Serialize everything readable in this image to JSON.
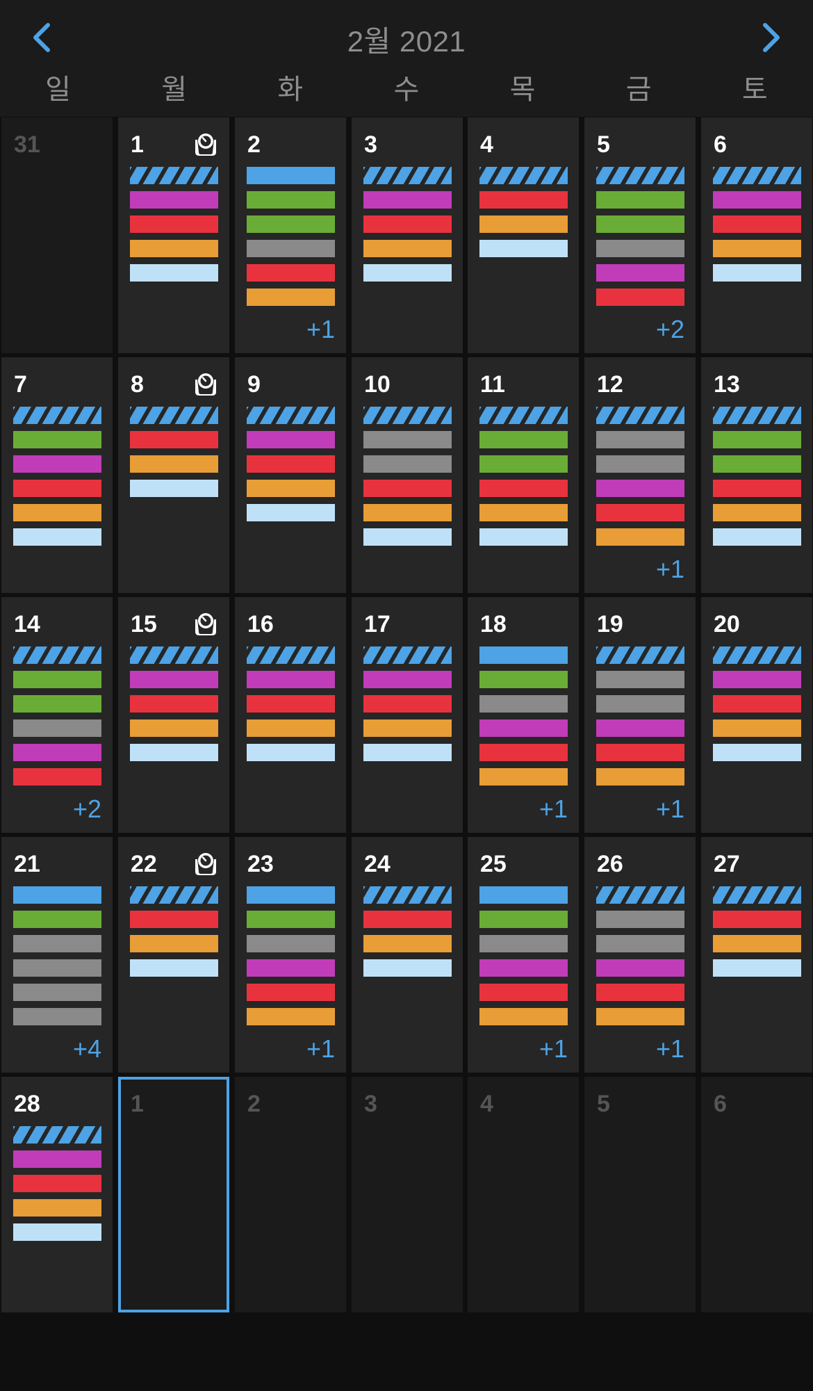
{
  "header": {
    "title": "2월 2021",
    "prev_icon": "chevron-left-icon",
    "next_icon": "chevron-right-icon",
    "accent": "#4da3e5"
  },
  "weekdays": [
    "일",
    "월",
    "화",
    "수",
    "목",
    "금",
    "토"
  ],
  "colors": {
    "stripe": "#4da3e5",
    "blue": "#4da3e5",
    "purple": "#c13cb8",
    "red": "#e8333f",
    "orange": "#e89d37",
    "lightblue": "#bfe1f7",
    "green": "#6aad36",
    "gray": "#8a8a8a"
  },
  "weeks": [
    [
      {
        "day": "31",
        "outside": true,
        "bars": []
      },
      {
        "day": "1",
        "icon": "timer-icon",
        "bars": [
          "stripe",
          "purple",
          "red",
          "orange",
          "lightblue"
        ]
      },
      {
        "day": "2",
        "bars": [
          "blue",
          "green",
          "green",
          "gray",
          "red",
          "orange"
        ],
        "more": "+1"
      },
      {
        "day": "3",
        "bars": [
          "stripe",
          "purple",
          "red",
          "orange",
          "lightblue"
        ]
      },
      {
        "day": "4",
        "bars": [
          "stripe",
          "red",
          "orange",
          "lightblue"
        ]
      },
      {
        "day": "5",
        "bars": [
          "stripe",
          "green",
          "green",
          "gray",
          "purple",
          "red"
        ],
        "more": "+2"
      },
      {
        "day": "6",
        "bars": [
          "stripe",
          "purple",
          "red",
          "orange",
          "lightblue"
        ]
      }
    ],
    [
      {
        "day": "7",
        "bars": [
          "stripe",
          "green",
          "purple",
          "red",
          "orange",
          "lightblue"
        ]
      },
      {
        "day": "8",
        "icon": "timer-icon",
        "bars": [
          "stripe",
          "red",
          "orange",
          "lightblue"
        ]
      },
      {
        "day": "9",
        "bars": [
          "stripe",
          "purple",
          "red",
          "orange",
          "lightblue"
        ]
      },
      {
        "day": "10",
        "bars": [
          "stripe",
          "gray",
          "gray",
          "red",
          "orange",
          "lightblue"
        ]
      },
      {
        "day": "11",
        "bars": [
          "stripe",
          "green",
          "green",
          "red",
          "orange",
          "lightblue"
        ]
      },
      {
        "day": "12",
        "bars": [
          "stripe",
          "gray",
          "gray",
          "purple",
          "red",
          "orange"
        ],
        "more": "+1"
      },
      {
        "day": "13",
        "bars": [
          "stripe",
          "green",
          "green",
          "red",
          "orange",
          "lightblue"
        ]
      }
    ],
    [
      {
        "day": "14",
        "bars": [
          "stripe",
          "green",
          "green",
          "gray",
          "purple",
          "red"
        ],
        "more": "+2"
      },
      {
        "day": "15",
        "icon": "timer-icon",
        "bars": [
          "stripe",
          "purple",
          "red",
          "orange",
          "lightblue"
        ]
      },
      {
        "day": "16",
        "bars": [
          "stripe",
          "purple",
          "red",
          "orange",
          "lightblue"
        ]
      },
      {
        "day": "17",
        "bars": [
          "stripe",
          "purple",
          "red",
          "orange",
          "lightblue"
        ]
      },
      {
        "day": "18",
        "bars": [
          "blue",
          "green",
          "gray",
          "purple",
          "red",
          "orange"
        ],
        "more": "+1"
      },
      {
        "day": "19",
        "bars": [
          "stripe",
          "gray",
          "gray",
          "purple",
          "red",
          "orange"
        ],
        "more": "+1"
      },
      {
        "day": "20",
        "bars": [
          "stripe",
          "purple",
          "red",
          "orange",
          "lightblue"
        ]
      }
    ],
    [
      {
        "day": "21",
        "bars": [
          "blue",
          "green",
          "gray",
          "gray",
          "gray",
          "gray"
        ],
        "more": "+4"
      },
      {
        "day": "22",
        "icon": "timer-icon",
        "bars": [
          "stripe",
          "red",
          "orange",
          "lightblue"
        ]
      },
      {
        "day": "23",
        "bars": [
          "blue",
          "green",
          "gray",
          "purple",
          "red",
          "orange"
        ],
        "more": "+1"
      },
      {
        "day": "24",
        "bars": [
          "stripe",
          "red",
          "orange",
          "lightblue"
        ]
      },
      {
        "day": "25",
        "bars": [
          "blue",
          "green",
          "gray",
          "purple",
          "red",
          "orange"
        ],
        "more": "+1"
      },
      {
        "day": "26",
        "bars": [
          "stripe",
          "gray",
          "gray",
          "purple",
          "red",
          "orange"
        ],
        "more": "+1"
      },
      {
        "day": "27",
        "bars": [
          "stripe",
          "red",
          "orange",
          "lightblue"
        ]
      }
    ],
    [
      {
        "day": "28",
        "bars": [
          "stripe",
          "purple",
          "red",
          "orange",
          "lightblue"
        ]
      },
      {
        "day": "1",
        "outside": true,
        "selected": true,
        "bars": []
      },
      {
        "day": "2",
        "outside": true,
        "bars": []
      },
      {
        "day": "3",
        "outside": true,
        "bars": []
      },
      {
        "day": "4",
        "outside": true,
        "bars": []
      },
      {
        "day": "5",
        "outside": true,
        "bars": []
      },
      {
        "day": "6",
        "outside": true,
        "bars": []
      }
    ]
  ]
}
